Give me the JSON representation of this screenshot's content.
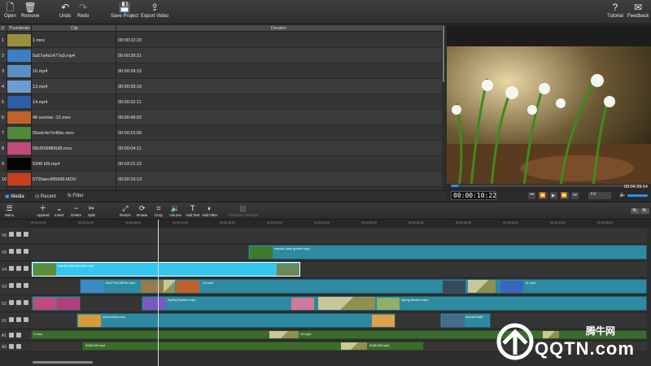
{
  "toolbar": {
    "open": "Open",
    "remove": "Remove",
    "undo": "Undo",
    "redo": "Redo",
    "save_project": "Save Project",
    "export_video": "Export Video",
    "tutorial": "Tutorial",
    "feedback": "Feedback"
  },
  "clip_table": {
    "headers": {
      "num": "#",
      "thumbnails": "Thumbnails",
      "clip": "Clip",
      "duration": "Duration"
    },
    "rows": [
      {
        "num": "1",
        "clip": "1.mov",
        "duration": "00:00:22:23",
        "color": "#9a8f3c"
      },
      {
        "num": "2",
        "clip": "5a57a4a1477a9.mp4",
        "duration": "00:00:28:21",
        "color": "#3a7fc4"
      },
      {
        "num": "3",
        "clip": "10.mp4",
        "duration": "00:00:28:15",
        "color": "#5a8fc2"
      },
      {
        "num": "4",
        "clip": "13.mp4",
        "duration": "00:00:39:16",
        "color": "#6f9ccf"
      },
      {
        "num": "5",
        "clip": "14.mp4",
        "duration": "00:00:32:11",
        "color": "#2c5fa8"
      },
      {
        "num": "6",
        "clip": "48 sunrise -12.mov",
        "duration": "00:00:49:02",
        "color": "#c0622a"
      },
      {
        "num": "7",
        "clip": "55edc4e7e46bc.mov",
        "duration": "00:00:15:00",
        "color": "#4f8a3a"
      },
      {
        "num": "8",
        "clip": "58cf5998f06d8.mov",
        "duration": "00:00:04:11",
        "color": "#c04a7a"
      },
      {
        "num": "9",
        "clip": "5345 b5f.mp4",
        "duration": "00:03:21:22",
        "color": "#050505"
      },
      {
        "num": "10",
        "clip": "5729aec495689.MOV",
        "duration": "00:00:16:13",
        "color": "#c8401a"
      }
    ]
  },
  "tabs": {
    "media": "Media",
    "recent": "Recent",
    "filter": "Filter"
  },
  "player": {
    "timecode": "00:00:10:22",
    "total": "00:04:39:14",
    "fit": "Fit"
  },
  "edit_tools": {
    "menu": "Menu",
    "append": "Append",
    "insert": "Insert",
    "delete": "Delete",
    "split": "Split",
    "resize": "Resize",
    "rotate": "Rotate",
    "crop": "Crop",
    "volume": "Volume",
    "add_text": "Add Text",
    "add_filter": "Add Filter",
    "transition_settings": "Transition Settings"
  },
  "ruler": [
    "00:00:00:00",
    "00:00:04:00",
    "00:00:08:00",
    "00:00:12:00",
    "00:00:16:00",
    "00:00:20:00",
    "00:00:24:00",
    "00:00:28:00",
    "00:00:32:00",
    "00:00:36:00",
    "00:00:40:00",
    "00:00:44:00",
    "00:00:48:00"
  ],
  "tracks": {
    "v6": "V6",
    "v5": "V5",
    "v4": "V4",
    "v3": "V3",
    "v2": "V2",
    "v1": "V1",
    "a1": "A1",
    "a2": "A2"
  },
  "clips": {
    "v5": "natural plant growth.mp4",
    "v4": "natural plant growth.mp4",
    "v3a": "5a577fc1487ab.mp4",
    "v3b": "10.mp4",
    "v3c": "14.mp4",
    "v2a": "Spring flowers.mp4",
    "v2b": "spring flowers.mp4",
    "v1a": "wheat field.mov",
    "v1b": "5a44b20d57",
    "a1": "1.mov",
    "a1b": "10.mp4",
    "a2": "5345 b5f.mp4",
    "a2b": "5345 b5f.mp4"
  },
  "watermark": {
    "cn": "腾牛网",
    "site": "QQTN.com"
  }
}
